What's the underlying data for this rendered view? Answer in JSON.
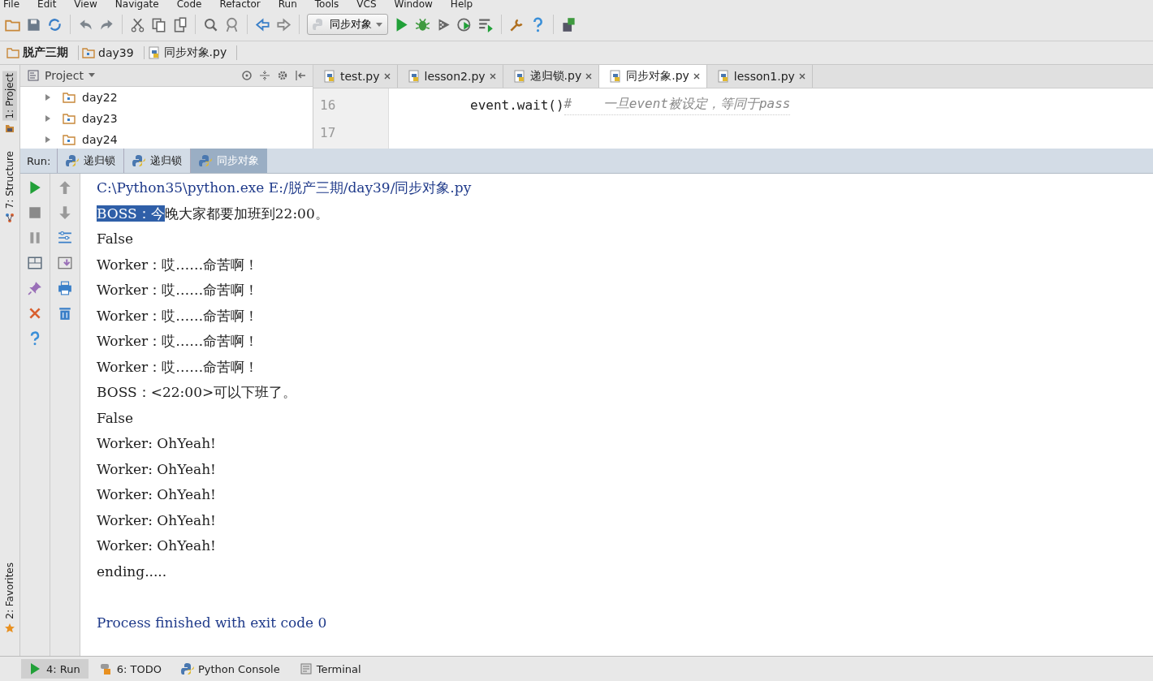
{
  "menu": [
    "File",
    "Edit",
    "View",
    "Navigate",
    "Code",
    "Refactor",
    "Run",
    "Tools",
    "VCS",
    "Window",
    "Help"
  ],
  "run_config": "同步对象",
  "breadcrumbs": [
    {
      "label": "脱产三期",
      "kind": "project"
    },
    {
      "label": "day39",
      "kind": "folder"
    },
    {
      "label": "同步对象.py",
      "kind": "file"
    }
  ],
  "side_tabs_top": [
    {
      "label": "1: Project",
      "selected": true
    }
  ],
  "side_tabs_mid": [
    {
      "label": "7: Structure",
      "selected": false
    }
  ],
  "side_tabs_bottom": [
    {
      "label": "2: Favorites",
      "selected": false
    }
  ],
  "project_pane": {
    "title": "Project",
    "items": [
      {
        "label": "day22",
        "expanded": false
      },
      {
        "label": "day23",
        "expanded": false
      },
      {
        "label": "day24",
        "expanded": false
      }
    ]
  },
  "editor_tabs": [
    {
      "label": "test.py",
      "selected": false
    },
    {
      "label": "lesson2.py",
      "selected": false
    },
    {
      "label": "递归锁.py",
      "selected": false
    },
    {
      "label": "同步对象.py",
      "selected": true
    },
    {
      "label": "lesson1.py",
      "selected": false
    }
  ],
  "editor_lines": [
    {
      "number": "16",
      "code": "event.wait()",
      "comment": "#    一旦event被设定，等同于pass"
    },
    {
      "number": "17"
    }
  ],
  "run_panel": {
    "label": "Run:",
    "tabs": [
      {
        "label": "递归锁",
        "selected": false
      },
      {
        "label": "递归锁",
        "selected": false
      },
      {
        "label": "同步对象",
        "selected": true
      }
    ]
  },
  "console": [
    {
      "kind": "command",
      "segments": [
        {
          "text": "C:\\Python35\\python.exe E:/脱产三期/day39/同步对象.py",
          "selected": false
        }
      ]
    },
    {
      "kind": "output",
      "segments": [
        {
          "text": "BOSS：今",
          "selected": true
        },
        {
          "text": "晚大家都要加班到22:00。",
          "selected": false
        }
      ]
    },
    {
      "kind": "output",
      "segments": [
        {
          "text": "False",
          "selected": false
        }
      ]
    },
    {
      "kind": "output",
      "segments": [
        {
          "text": "Worker：哎……命苦啊！",
          "selected": false
        }
      ]
    },
    {
      "kind": "output",
      "segments": [
        {
          "text": "Worker：哎……命苦啊！",
          "selected": false
        }
      ]
    },
    {
      "kind": "output",
      "segments": [
        {
          "text": "Worker：哎……命苦啊！",
          "selected": false
        }
      ]
    },
    {
      "kind": "output",
      "segments": [
        {
          "text": "Worker：哎……命苦啊！",
          "selected": false
        }
      ]
    },
    {
      "kind": "output",
      "segments": [
        {
          "text": "Worker：哎……命苦啊！",
          "selected": false
        }
      ]
    },
    {
      "kind": "output",
      "segments": [
        {
          "text": "BOSS：<22:00>可以下班了。",
          "selected": false
        }
      ]
    },
    {
      "kind": "output",
      "segments": [
        {
          "text": "False",
          "selected": false
        }
      ]
    },
    {
      "kind": "output",
      "segments": [
        {
          "text": "Worker: OhYeah!",
          "selected": false
        }
      ]
    },
    {
      "kind": "output",
      "segments": [
        {
          "text": "Worker: OhYeah!",
          "selected": false
        }
      ]
    },
    {
      "kind": "output",
      "segments": [
        {
          "text": "Worker: OhYeah!",
          "selected": false
        }
      ]
    },
    {
      "kind": "output",
      "segments": [
        {
          "text": "Worker: OhYeah!",
          "selected": false
        }
      ]
    },
    {
      "kind": "output",
      "segments": [
        {
          "text": "Worker: OhYeah!",
          "selected": false
        }
      ]
    },
    {
      "kind": "output",
      "segments": [
        {
          "text": "ending.....",
          "selected": false
        }
      ]
    },
    {
      "kind": "blank"
    },
    {
      "kind": "exit",
      "segments": [
        {
          "text": "Process finished with exit code 0",
          "selected": false
        }
      ]
    }
  ],
  "bottom_tabs": [
    {
      "label": "4: Run",
      "kind": "run",
      "selected": true
    },
    {
      "label": "6: TODO",
      "kind": "todo",
      "selected": false
    },
    {
      "label": "Python Console",
      "kind": "python",
      "selected": false
    },
    {
      "label": "Terminal",
      "kind": "terminal",
      "selected": false
    }
  ]
}
